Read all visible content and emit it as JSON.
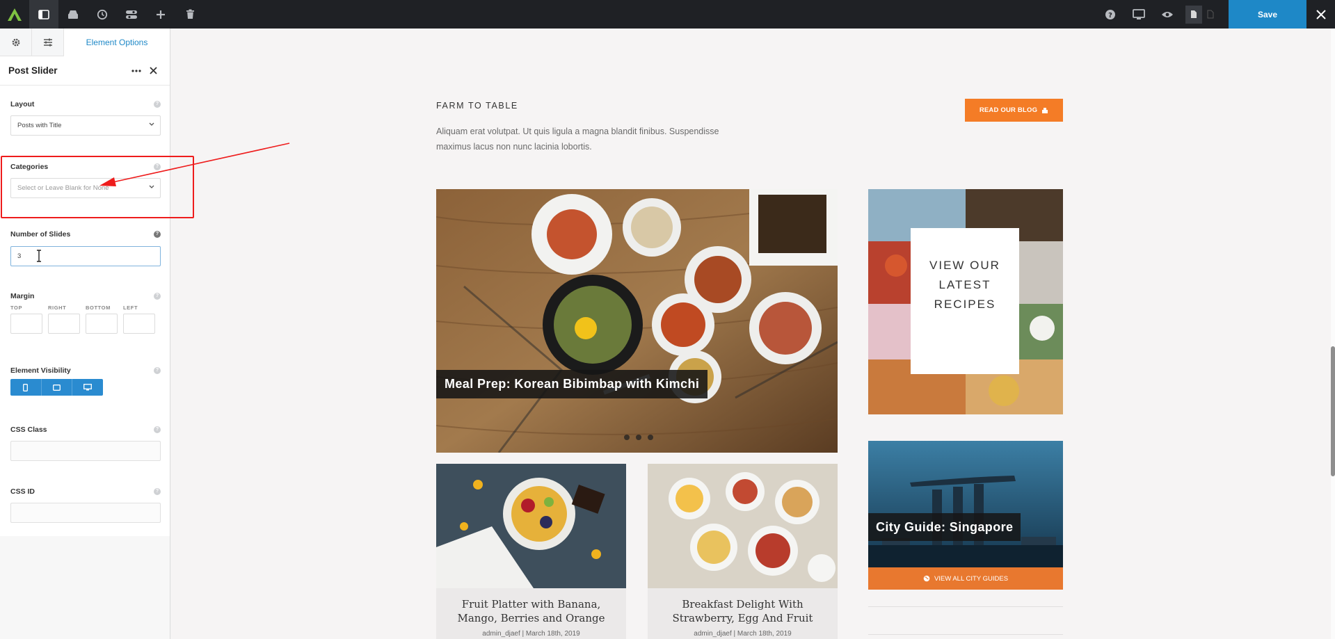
{
  "toolbar": {
    "save_label": "Save"
  },
  "panel": {
    "tab_label": "Element Options",
    "title": "Post Slider",
    "layout": {
      "label": "Layout",
      "value": "Posts with Title"
    },
    "categories": {
      "label": "Categories",
      "placeholder": "Select or Leave Blank for None"
    },
    "slides": {
      "label": "Number of Slides",
      "value": "3"
    },
    "margin": {
      "label": "Margin",
      "top": "TOP",
      "right": "RIGHT",
      "bottom": "BOTTOM",
      "left": "LEFT"
    },
    "visibility": {
      "label": "Element Visibility"
    },
    "css_class": {
      "label": "CSS Class"
    },
    "css_id": {
      "label": "CSS ID"
    },
    "help_glyph": "?"
  },
  "page": {
    "eyebrow": "FARM TO TABLE",
    "intro": "Aliquam erat volutpat. Ut quis ligula a magna blandit finibus. Suspendisse maximus lacus non nunc lacinia lobortis.",
    "blog_button": "READ OUR BLOG",
    "hero_caption": "Meal Prep: Korean Bibimbap with Kimchi",
    "cards": [
      {
        "title": "Fruit Platter with Banana, Mango, Berries and Orange",
        "meta": "admin_djaef | March 18th, 2019"
      },
      {
        "title": "Breakfast Delight With Strawberry, Egg And Fruit",
        "meta": "admin_djaef | March 18th, 2019"
      }
    ],
    "recipes_text": "VIEW OUR LATEST RECIPES",
    "city_caption": "City Guide: Singapore",
    "city_button": "VIEW ALL CITY GUIDES"
  },
  "colors": {
    "accent_blue": "#1e88c7",
    "accent_orange": "#f47c26",
    "highlight_red": "#ee1c1c"
  }
}
